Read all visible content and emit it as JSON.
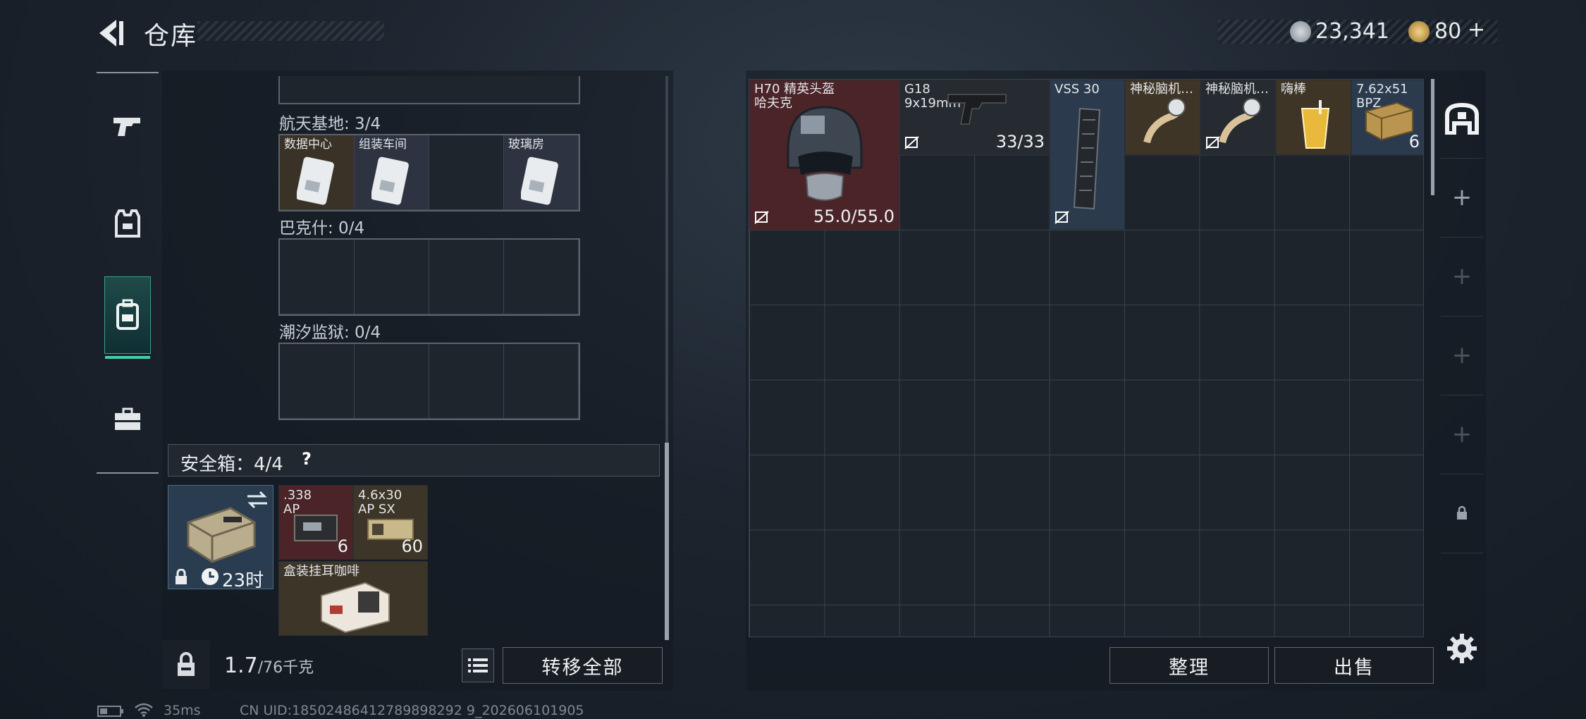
{
  "header": {
    "title": "仓库"
  },
  "currency": {
    "silver": "23,341",
    "gold": "80",
    "gold_plus": "+"
  },
  "nav": {
    "items": [
      "weapons",
      "armor",
      "backpack",
      "case"
    ],
    "active_index": 2
  },
  "left": {
    "section1": {
      "label": "航天基地: 3/4",
      "items": [
        "数据中心",
        "组装车间",
        "",
        "玻璃房"
      ]
    },
    "section2": {
      "label": "巴克什: 0/4"
    },
    "section3": {
      "label": "潮汐监狱: 0/4"
    },
    "safe": {
      "title": "安全箱：4/4",
      "help": "?",
      "timer": "23时",
      "items": [
        {
          "label": ".338\nAP",
          "count": "6"
        },
        {
          "label": "4.6x30\nAP SX",
          "count": "60"
        },
        {
          "label": "盒装挂耳咖啡",
          "count": ""
        }
      ]
    },
    "weight": {
      "current": "1.7",
      "max": "/76千克"
    },
    "transfer_all": "转移全部"
  },
  "inventory": {
    "items": [
      {
        "label": "H70 精英头盔\n哈夫克",
        "value": "55.0/55.0"
      },
      {
        "label": "G18\n9x19mm",
        "value": "33/33"
      },
      {
        "label": "VSS 30",
        "value": ""
      },
      {
        "label": "神秘脑机…",
        "value": ""
      },
      {
        "label": "神秘脑机…",
        "value": ""
      },
      {
        "label": "嗨棒",
        "value": ""
      },
      {
        "label": "7.62x51\nBPZ",
        "value": "6"
      }
    ],
    "sort_label": "整理",
    "sell_label": "出售"
  },
  "status_bar": {
    "ping": "35ms",
    "uid": "CN UID:18502486412789898292 9_202606101905"
  },
  "colors": {
    "accent": "#3fd0a8",
    "panel": "#1e242b"
  }
}
